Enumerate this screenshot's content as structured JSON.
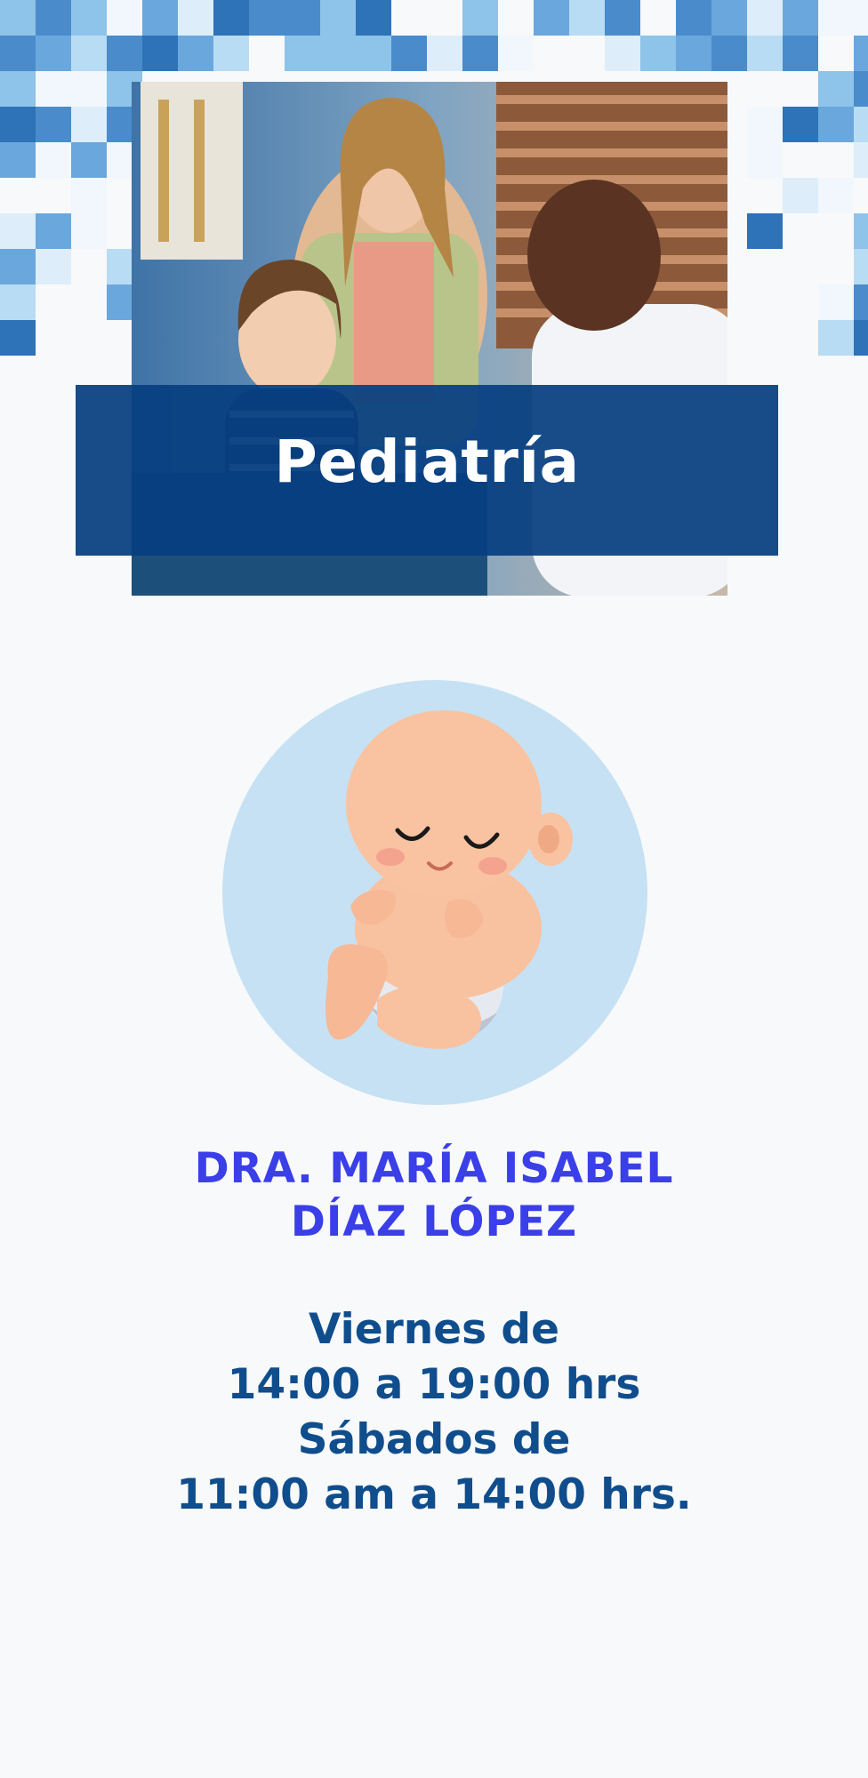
{
  "banner": {
    "title": "Pediatría"
  },
  "doctor": {
    "name_line1": "DRA. MARÍA ISABEL",
    "name_line2": "DÍAZ LÓPEZ"
  },
  "schedule": {
    "line1": "Viernes de",
    "line2": "14:00 a 19:00 hrs",
    "line3": "Sábados de",
    "line4": "11:00 am a 14:00 hrs."
  },
  "colors": {
    "banner_bg": "#063e80",
    "doctor_text": "#3a3fe8",
    "schedule_text": "#0f4d8c",
    "page_bg": "#f8f9fa",
    "circle_bg": "#c6e1f4"
  },
  "images": {
    "photo": "photo of a doctor examining a young girl with her mother",
    "illustration": "baby-illustration"
  }
}
